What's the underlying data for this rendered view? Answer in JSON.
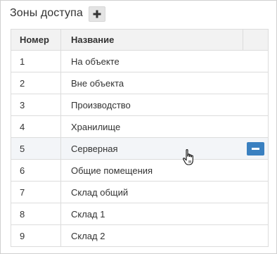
{
  "header": {
    "title": "Зоны доступа",
    "add_icon": "plus-icon"
  },
  "table": {
    "columns": [
      "Номер",
      "Название"
    ],
    "rows": [
      {
        "num": "1",
        "name": "На объекте"
      },
      {
        "num": "2",
        "name": "Вне объекта"
      },
      {
        "num": "3",
        "name": "Производство"
      },
      {
        "num": "4",
        "name": "Хранилище"
      },
      {
        "num": "5",
        "name": "Серверная",
        "hovered": true,
        "action_icon": "minus-icon"
      },
      {
        "num": "6",
        "name": "Общие помещения"
      },
      {
        "num": "7",
        "name": "Склад общий"
      },
      {
        "num": "8",
        "name": "Склад 1"
      },
      {
        "num": "9",
        "name": "Склад 2"
      }
    ]
  },
  "colors": {
    "accent": "#3a80c0",
    "header_bg": "#f2f2f2",
    "hover_bg": "#f3f5f8"
  },
  "cursor_icon": "hand-pointer-icon"
}
